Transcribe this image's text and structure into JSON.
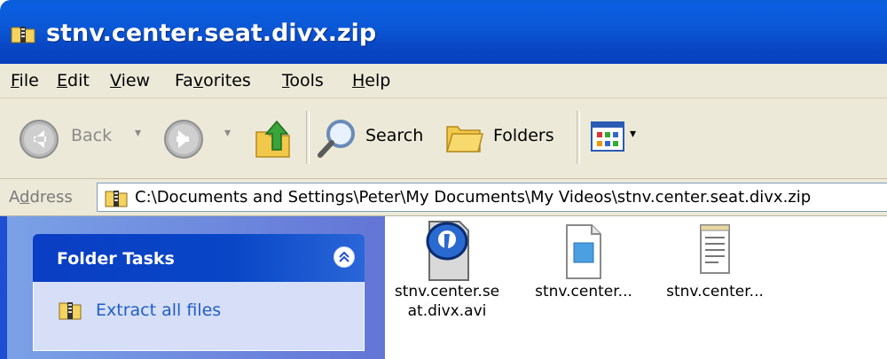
{
  "window": {
    "title": "stnv.center.seat.divx.zip",
    "icon": "zip-folder-icon"
  },
  "menu": [
    {
      "key": "file",
      "first": "F",
      "rest": "ile"
    },
    {
      "key": "edit",
      "first": "E",
      "rest": "dit"
    },
    {
      "key": "view",
      "first": "V",
      "rest": "iew"
    },
    {
      "key": "favorites",
      "first": "Fa",
      "u": "v",
      "rest": "orites"
    },
    {
      "key": "tools",
      "first": "T",
      "rest": "ools"
    },
    {
      "key": "help",
      "first": "H",
      "rest": "elp"
    }
  ],
  "toolbar": {
    "back_label": "Back",
    "search_label": "Search",
    "folders_label": "Folders"
  },
  "address": {
    "label": "Address",
    "label_underline": "d",
    "path": "C:\\Documents and Settings\\Peter\\My Documents\\My Videos\\stnv.center.seat.divx.zip"
  },
  "tasks": {
    "header": "Folder Tasks",
    "items": [
      {
        "label": "Extract all files",
        "icon": "zip-folder-icon"
      }
    ]
  },
  "files": [
    {
      "label": "stnv.center.se\nat.divx.avi",
      "icon": "realplayer-icon"
    },
    {
      "label": "stnv.center...",
      "icon": "image-file-icon"
    },
    {
      "label": "stnv.center...",
      "icon": "text-file-icon"
    }
  ]
}
